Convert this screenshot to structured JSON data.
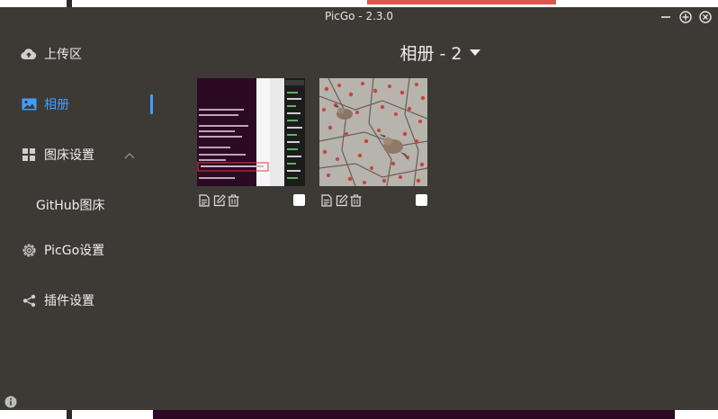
{
  "window": {
    "title": "PicGo - 2.3.0"
  },
  "controls": {
    "minimize_icon": "minus-icon",
    "maximize_icon": "plus-circle-icon",
    "close_icon": "close-circle-icon"
  },
  "sidebar": {
    "items": [
      {
        "label": "上传区",
        "icon": "cloud-upload-icon"
      },
      {
        "label": "相册",
        "icon": "image-icon",
        "active": true
      },
      {
        "label": "图床设置",
        "icon": "grid-icon",
        "expanded": true
      },
      {
        "label": "PicGo设置",
        "icon": "gear-icon"
      },
      {
        "label": "插件设置",
        "icon": "share-icon"
      }
    ],
    "sub_items": [
      {
        "label": "GitHub图床"
      }
    ],
    "info_icon": "info-icon"
  },
  "gallery": {
    "title": "相册 - 2",
    "dropdown_icon": "caret-down-icon",
    "images": [
      {
        "kind": "terminal-screenshot",
        "selected": false
      },
      {
        "kind": "bird-photo",
        "selected": false
      }
    ],
    "tool_icons": [
      "copy-icon",
      "edit-icon",
      "delete-icon"
    ]
  },
  "colors": {
    "window_bg": "#3d3a36",
    "accent": "#409eff",
    "text": "#eeeeee"
  }
}
